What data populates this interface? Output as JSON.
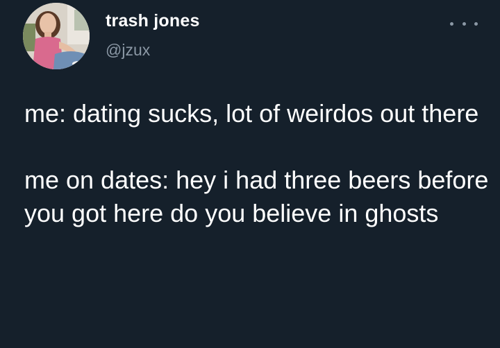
{
  "tweet": {
    "author": {
      "display_name": "trash jones",
      "handle": "@jzux",
      "avatar_icon": "profile-photo"
    },
    "more_icon": "more-options-icon",
    "text": {
      "paragraph_1": "me: dating sucks, lot of weirdos out there",
      "paragraph_2": "me on dates: hey i had three beers before you got here do you believe in ghosts"
    }
  },
  "colors": {
    "background": "#15202b",
    "text_primary": "#ffffff",
    "text_secondary": "#8b98a5"
  }
}
